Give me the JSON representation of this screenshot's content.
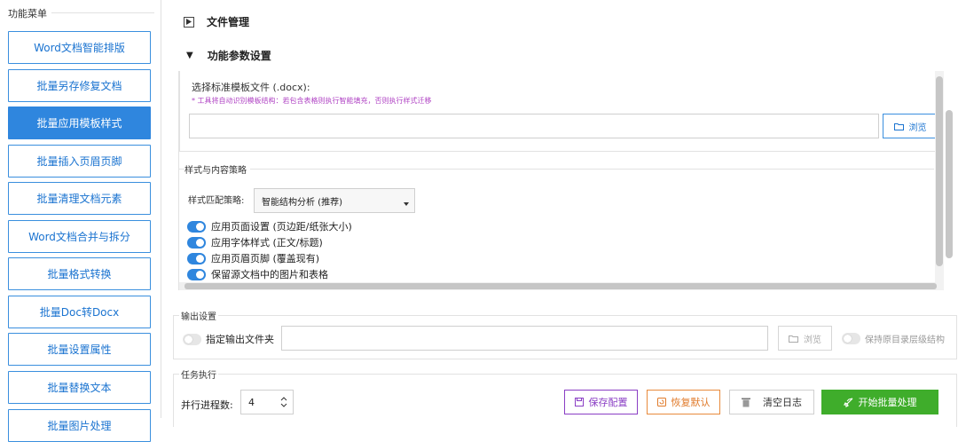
{
  "sidebar": {
    "title": "功能菜单",
    "items": [
      {
        "label": "Word文档智能排版",
        "active": false
      },
      {
        "label": "批量另存修复文档",
        "active": false
      },
      {
        "label": "批量应用模板样式",
        "active": true
      },
      {
        "label": "批量插入页眉页脚",
        "active": false
      },
      {
        "label": "批量清理文档元素",
        "active": false
      },
      {
        "label": "Word文档合并与拆分",
        "active": false
      },
      {
        "label": "批量格式转换",
        "active": false
      },
      {
        "label": "批量Doc转Docx",
        "active": false
      },
      {
        "label": "批量设置属性",
        "active": false
      },
      {
        "label": "批量替换文本",
        "active": false
      },
      {
        "label": "批量图片处理",
        "active": false
      }
    ]
  },
  "sections": {
    "file_management": "文件管理",
    "params": "功能参数设置"
  },
  "template": {
    "label": "选择标准模板文件 (.docx):",
    "hint": "* 工具将自动识别模板结构：若包含表格则执行智能填充，否则执行样式迁移",
    "path_value": "",
    "browse_label": "浏览"
  },
  "style_policy": {
    "title": "样式与内容策略",
    "strategy_label": "样式匹配策略:",
    "strategy_value": "智能结构分析 (推荐)",
    "toggles": [
      {
        "label": "应用页面设置 (页边距/纸张大小)",
        "on": true
      },
      {
        "label": "应用字体样式 (正文/标题)",
        "on": true
      },
      {
        "label": "应用页眉页脚 (覆盖现有)",
        "on": true
      },
      {
        "label": "保留源文档中的图片和表格",
        "on": true
      }
    ]
  },
  "output": {
    "title": "输出设置",
    "specify_folder_label": "指定输出文件夹",
    "folder_value": "",
    "browse_label": "浏览",
    "keep_structure_label": "保持原目录层级结构"
  },
  "task": {
    "title": "任务执行",
    "process_count_label": "并行进程数:",
    "process_count_value": "4",
    "save_config": "保存配置",
    "restore_default": "恢复默认",
    "clear_log": "清空日志",
    "start": "开始批量处理"
  },
  "colors": {
    "accent": "#2f86de",
    "purple": "#8a3ec4",
    "orange": "#e88a3c",
    "green": "#3fad2b"
  }
}
